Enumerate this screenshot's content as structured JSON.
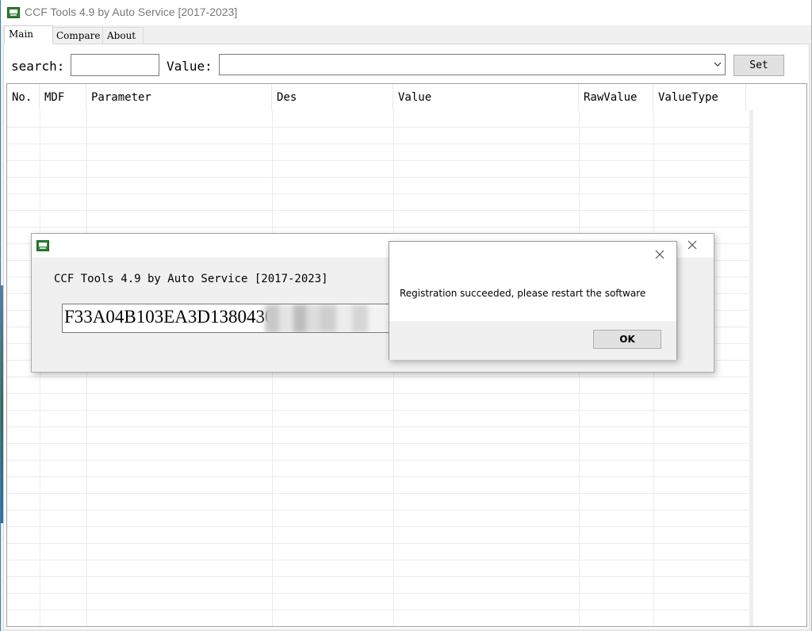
{
  "window": {
    "title": "CCF Tools 4.9 by Auto Service [2017-2023]",
    "icon": "ccf-app-icon"
  },
  "tabs": [
    {
      "label": "Main",
      "active": true
    },
    {
      "label": "Compare",
      "active": false
    },
    {
      "label": "About",
      "active": false
    }
  ],
  "toolbar": {
    "search_label": "search:",
    "search_value": "",
    "value_label": "Value:",
    "value_selected": "",
    "set_label": "Set"
  },
  "table": {
    "columns": [
      "No.",
      "MDF",
      "Parameter",
      "Des",
      "Value",
      "RawValue",
      "ValueType"
    ],
    "rows": []
  },
  "registration_dialog": {
    "title_text": "CCF Tools 4.9 by Auto Service [2017-2023]",
    "code_visible": "F33A04B103EA3D1380430I",
    "close_icon": "close-icon"
  },
  "message_box": {
    "message": "Registration succeeded, please restart the software",
    "ok_label": "OK",
    "close_icon": "close-icon"
  },
  "colors": {
    "accent_border": "#3c7fb1",
    "icon_green": "#2e7d32",
    "dialog_bg": "#f0f0f0",
    "button_bg": "#e1e1e1"
  }
}
